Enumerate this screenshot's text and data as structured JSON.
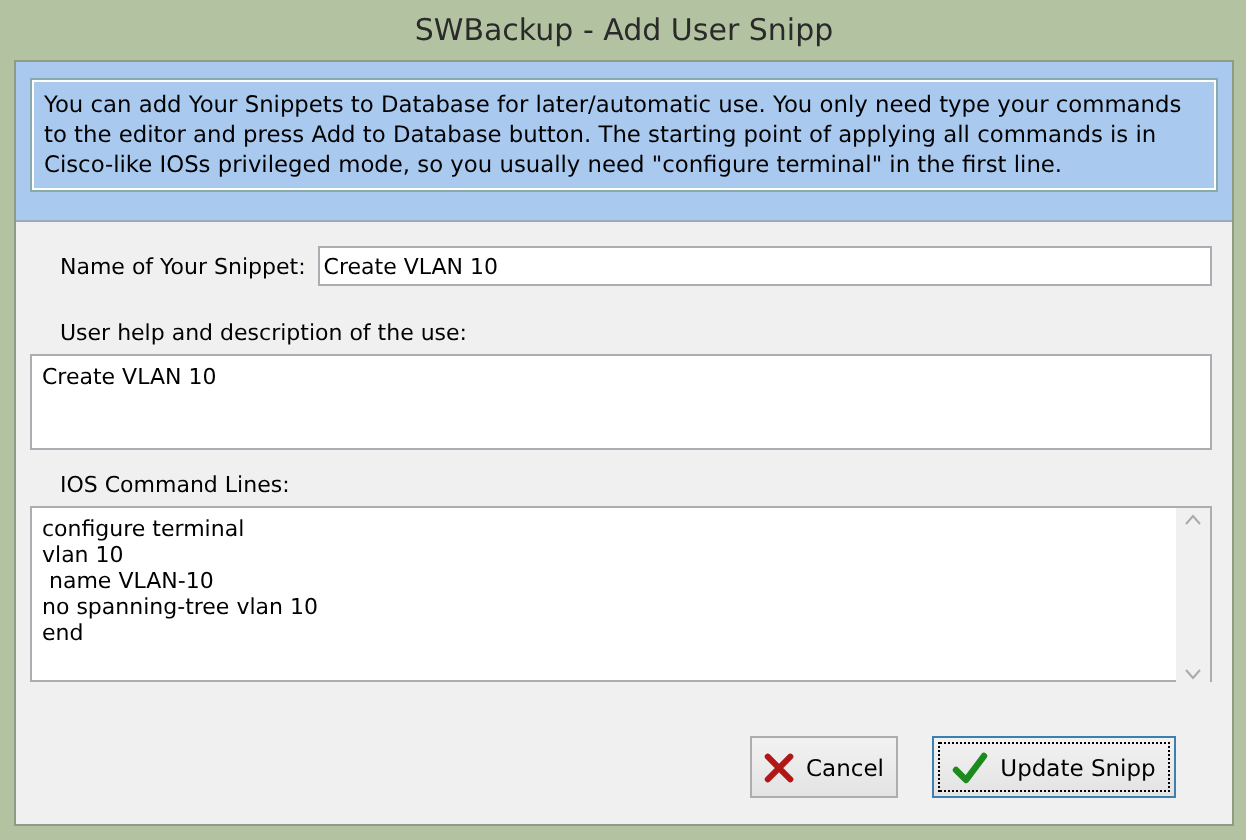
{
  "window": {
    "title": "SWBackup - Add User Snipp"
  },
  "info": "You can add Your Snippets to Database for later/automatic use. You only need type your commands to the editor and press Add to Database button. The starting point of applying all commands is in Cisco-like IOSs privileged mode, so you usually need \"configure terminal\" in the first line.",
  "name_field": {
    "label": "Name of Your Snippet:",
    "value": "Create VLAN 10"
  },
  "help_field": {
    "label": "User help and description of the use:",
    "value": "Create VLAN 10"
  },
  "commands_field": {
    "label": "IOS Command Lines:",
    "value": "configure terminal\nvlan 10\n name VLAN-10\nno spanning-tree vlan 10\nend"
  },
  "buttons": [
    {
      "label": "Cancel",
      "kind": "cancel",
      "selected": false
    },
    {
      "label": "Update Snipp",
      "kind": "ok",
      "selected": true
    }
  ]
}
